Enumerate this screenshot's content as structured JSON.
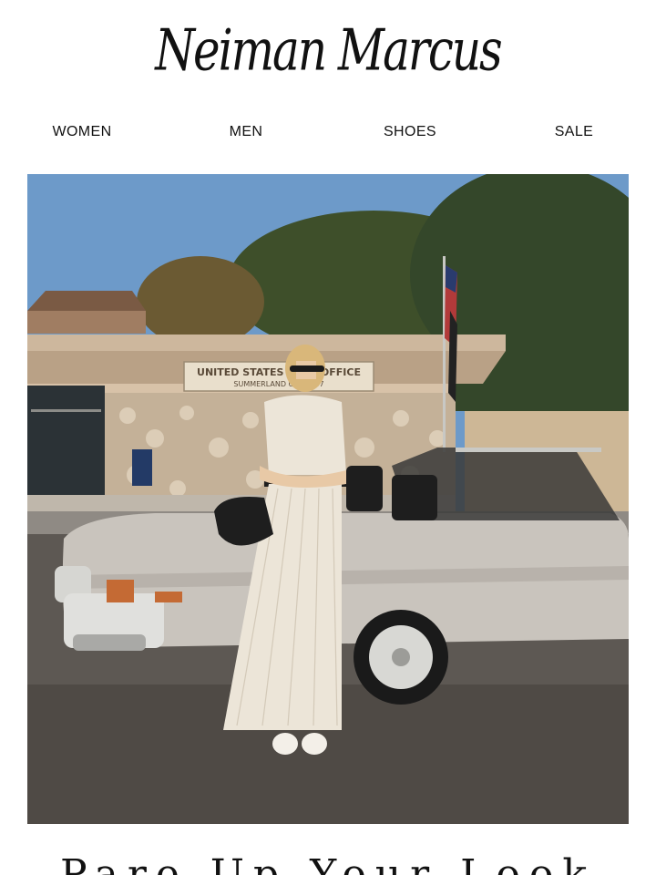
{
  "brand": {
    "logo_text": "Neiman Marcus"
  },
  "nav": {
    "items": [
      {
        "label": "WOMEN",
        "icon": "",
        "name": "nav-item-women"
      },
      {
        "label": "MEN",
        "name": "nav-item-men"
      },
      {
        "label": "SHOES",
        "name": "nav-item-shoes"
      },
      {
        "label": "SALE",
        "name": "nav-item-sale"
      }
    ]
  },
  "hero": {
    "sign_line1": "UNITED STATES POST OFFICE",
    "sign_line2": "SUMMERLAND CA 93067"
  },
  "headline": {
    "text": "Pare Up Your Look"
  },
  "colors": {
    "sky": "#6d9ac9",
    "building": "#d8c2a8",
    "car": "#c9c4bd",
    "asphalt": "#5d5853",
    "dress": "#ece5d8"
  }
}
